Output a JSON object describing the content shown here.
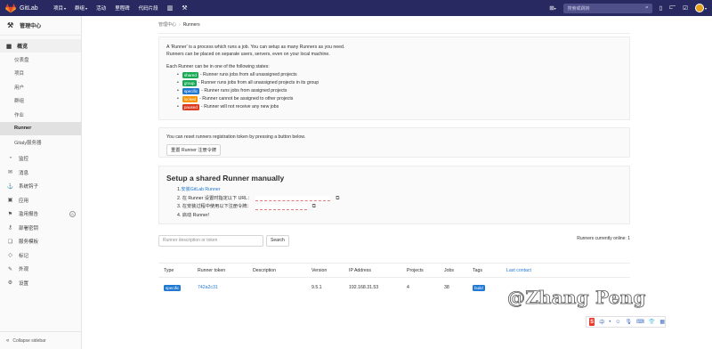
{
  "topbar": {
    "brand": "GitLab",
    "nav": [
      "项目",
      "群组",
      "活动",
      "里程碑",
      "代码片段"
    ],
    "search_placeholder": "搜索或跳转",
    "icons": [
      "tanuki-logo",
      "chart-icon",
      "wrench-icon",
      "plus-icon",
      "search-icon",
      "issues-icon",
      "merge-request-icon",
      "todo-icon",
      "user-avatar"
    ]
  },
  "sidebar": {
    "context_title": "管理中心",
    "overview": {
      "label": "概览",
      "items": [
        "仪表盘",
        "项目",
        "用户",
        "群组",
        "作业",
        "Runner",
        "Gitaly服务器"
      ],
      "active_index": 5
    },
    "items": [
      {
        "label": "监控",
        "icon": "monitor-icon"
      },
      {
        "label": "消息",
        "icon": "messages-icon"
      },
      {
        "label": "系统钩子",
        "icon": "hook-icon"
      },
      {
        "label": "应用",
        "icon": "applications-icon"
      },
      {
        "label": "滥用报告",
        "icon": "abuse-icon",
        "badge": "0"
      },
      {
        "label": "部署密钥",
        "icon": "key-icon"
      },
      {
        "label": "服务模板",
        "icon": "template-icon"
      },
      {
        "label": "标记",
        "icon": "label-icon"
      },
      {
        "label": "外观",
        "icon": "appearance-icon"
      },
      {
        "label": "设置",
        "icon": "settings-icon"
      }
    ],
    "collapse_label": "Collapse sidebar"
  },
  "breadcrumb": {
    "parent": "管理中心",
    "current": "Runners"
  },
  "info": {
    "intro1": "A 'Runner' is a process which runs a job. You can setup as many Runners as you need.",
    "intro2": "Runners can be placed on separate users, servers, even on your local machine.",
    "states_intro": "Each Runner can be in one of the following states:",
    "states": [
      {
        "tag": "shared",
        "text": "- Runner runs jobs from all unassigned projects",
        "color": "#1aaa55"
      },
      {
        "tag": "group",
        "text": "- Runner runs jobs from all unassigned projects in its group",
        "color": "#1aaa55"
      },
      {
        "tag": "specific",
        "text": "- Runner runs jobs from assigned projects",
        "color": "#1f78d1"
      },
      {
        "tag": "locked",
        "text": "- Runner cannot be assigned to other projects",
        "color": "#fc9403"
      },
      {
        "tag": "paused",
        "text": "- Runner will not receive any new jobs",
        "color": "#db3b21"
      }
    ]
  },
  "reset": {
    "text": "You can reset runners registration token by pressing a button below.",
    "button": "重置 Runner 注册令牌"
  },
  "setup": {
    "title": "Setup a shared Runner manually",
    "step1_prefix": "1. ",
    "step1_link": "安装GitLab Runner",
    "step2": "2. 在 Runner 设置时指定以下 URL：",
    "step3": "3. 在安装过程中使用以下注册令牌：",
    "step4": "4. 启动 Runner!"
  },
  "filter": {
    "placeholder": "Runner description or token",
    "search_button": "Search",
    "online": "Runners currently online: 1"
  },
  "table": {
    "headers": [
      "Type",
      "Runner token",
      "Description",
      "Version",
      "IP Address",
      "Projects",
      "Jobs",
      "Tags",
      "Last contact"
    ],
    "rows": [
      {
        "type": "specific",
        "token": "742a2c31",
        "description": "",
        "version": "9.5.1",
        "ip": "192.168.31.53",
        "projects": "4",
        "jobs": "38",
        "tags": "build"
      }
    ]
  },
  "watermark": "@Zhang Peng",
  "ime": {
    "logo": "S",
    "icons": [
      "中",
      "•",
      "☺",
      "mic-icon",
      "keyboard-icon",
      "shirt-icon",
      "grid-icon"
    ]
  }
}
